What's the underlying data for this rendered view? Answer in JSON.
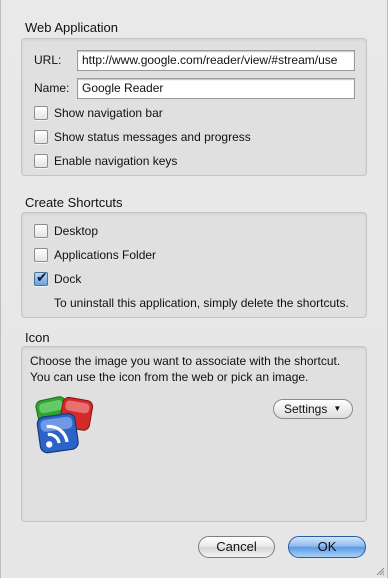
{
  "web_app": {
    "title": "Web Application",
    "url_label": "URL:",
    "url_value": "http://www.google.com/reader/view/#stream/use",
    "name_label": "Name:",
    "name_value": "Google Reader",
    "options": [
      {
        "label": "Show navigation bar",
        "checked": false
      },
      {
        "label": "Show status messages and progress",
        "checked": false
      },
      {
        "label": "Enable navigation keys",
        "checked": false
      }
    ]
  },
  "shortcuts": {
    "title": "Create Shortcuts",
    "options": [
      {
        "label": "Desktop",
        "checked": false
      },
      {
        "label": "Applications Folder",
        "checked": false
      },
      {
        "label": "Dock",
        "checked": true
      }
    ],
    "hint": "To uninstall this application, simply delete the shortcuts."
  },
  "icon": {
    "title": "Icon",
    "description_line1": "Choose the image you want to associate with the shortcut.",
    "description_line2": "You can use the icon from the web or pick an image.",
    "settings_label": "Settings",
    "icon_name": "google-reader-icon"
  },
  "buttons": {
    "cancel_label": "Cancel",
    "ok_label": "OK"
  },
  "colors": {
    "accent": "#5e9ae4",
    "check_fill": "#6aa2e0"
  }
}
